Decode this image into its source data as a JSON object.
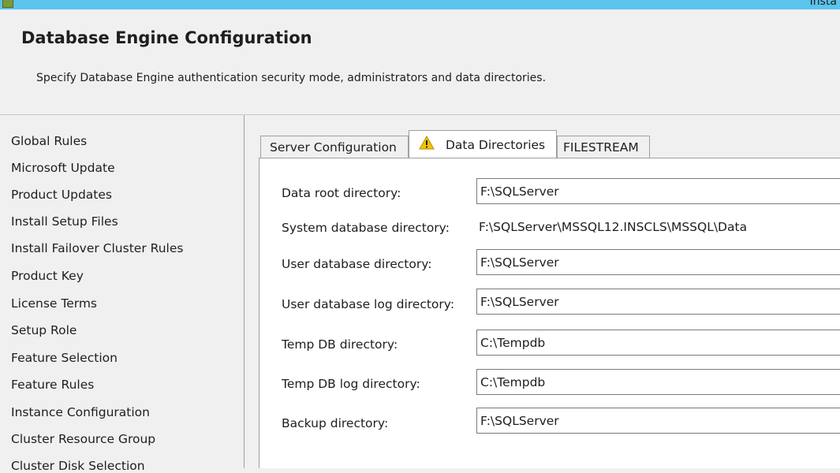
{
  "window": {
    "title": "Insta"
  },
  "header": {
    "title": "Database Engine Configuration",
    "subtitle": "Specify Database Engine authentication security mode, administrators and data directories."
  },
  "sidebar": {
    "items": [
      "Global Rules",
      "Microsoft Update",
      "Product Updates",
      "Install Setup Files",
      "Install Failover Cluster Rules",
      "Product Key",
      "License Terms",
      "Setup Role",
      "Feature Selection",
      "Feature Rules",
      "Instance Configuration",
      "Cluster Resource Group",
      "Cluster Disk Selection"
    ]
  },
  "tabs": [
    {
      "label": "Server Configuration"
    },
    {
      "label": "Data Directories",
      "icon": "warning-icon",
      "active": true
    },
    {
      "label": "FILESTREAM"
    }
  ],
  "fields": {
    "data_root": {
      "label": "Data root directory:",
      "value": "F:\\SQLServer"
    },
    "system_db": {
      "label": "System database directory:",
      "value": "F:\\SQLServer\\MSSQL12.INSCLS\\MSSQL\\Data"
    },
    "user_db": {
      "label": "User database directory:",
      "value": "F:\\SQLServer"
    },
    "user_db_log": {
      "label": "User database log directory:",
      "value": "F:\\SQLServer"
    },
    "temp_db": {
      "label": "Temp DB directory:",
      "value": "C:\\Tempdb"
    },
    "temp_db_log": {
      "label": "Temp DB log directory:",
      "value": "C:\\Tempdb"
    },
    "backup": {
      "label": "Backup directory:",
      "value": "F:\\SQLServer"
    }
  },
  "colors": {
    "titlebar": "#5bc4ec",
    "warning": "#f5c400",
    "panel": "#ffffff",
    "background": "#f0f0f0"
  }
}
